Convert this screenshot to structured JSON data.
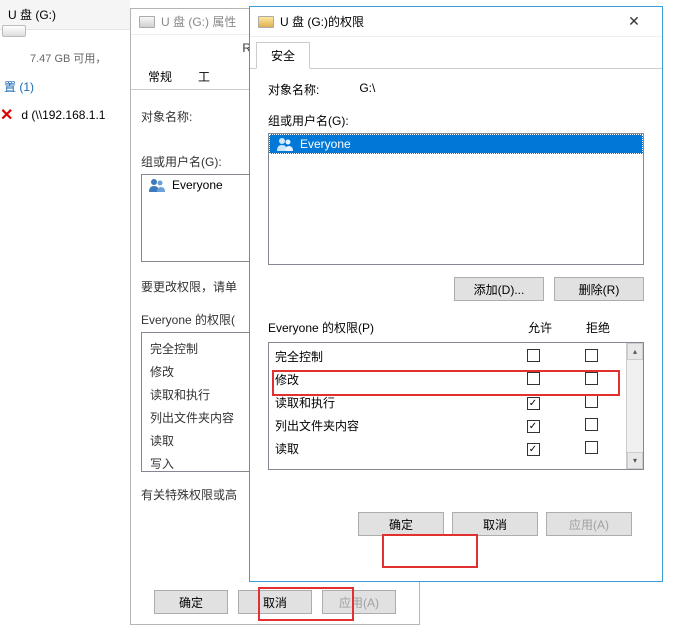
{
  "desktop": {
    "drive_title": "U 盘 (G:)",
    "drive_info": "7.47 GB 可用，",
    "group_heading": "置 (1)",
    "net_drive": "d (\\\\192.168.1.1"
  },
  "props": {
    "title": "U 盘 (G:) 属性",
    "readyboost": "ReadyBoost",
    "tabs": {
      "general": "常规",
      "tools": "工"
    },
    "object_label": "对象名称:",
    "groups_label": "组或用户名(G):",
    "user_everyone": "Everyone",
    "change_hint": "要更改权限，请单",
    "perm_label": "Everyone 的权限(",
    "perms": [
      "完全控制",
      "修改",
      "读取和执行",
      "列出文件夹内容",
      "读取",
      "写入"
    ],
    "adv_hint": "有关特殊权限或高",
    "buttons": {
      "ok": "确定",
      "cancel": "取消",
      "apply": "应用(A)"
    }
  },
  "perm": {
    "title": "U 盘 (G:)的权限",
    "tab_security": "安全",
    "object_label": "对象名称:",
    "object_value": "G:\\",
    "groups_label": "组或用户名(G):",
    "user_everyone": "Everyone",
    "add_btn": "添加(D)...",
    "remove_btn": "删除(R)",
    "perm_label": "Everyone 的权限(P)",
    "col_allow": "允许",
    "col_deny": "拒绝",
    "rows": [
      {
        "name": "完全控制",
        "allow": false,
        "deny": false
      },
      {
        "name": "修改",
        "allow": false,
        "deny": false
      },
      {
        "name": "读取和执行",
        "allow": true,
        "deny": false
      },
      {
        "name": "列出文件夹内容",
        "allow": true,
        "deny": false
      },
      {
        "name": "读取",
        "allow": true,
        "deny": false
      }
    ],
    "buttons": {
      "ok": "确定",
      "cancel": "取消",
      "apply": "应用(A)"
    }
  }
}
